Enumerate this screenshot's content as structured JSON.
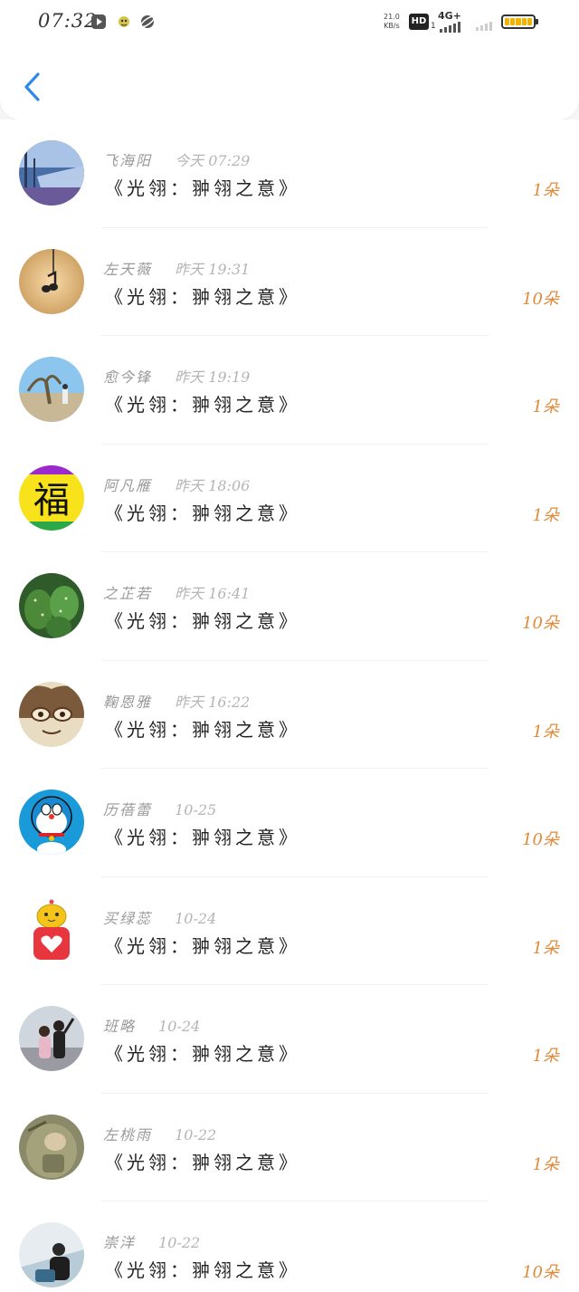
{
  "status_bar": {
    "time": "07:32",
    "net_speed_value": "21.0",
    "net_speed_unit": "KB/s",
    "hd_label": "HD",
    "hd_sub": "1",
    "network_type": "4G+",
    "icons": [
      "play-icon",
      "bird-icon",
      "planet-icon",
      "signal-icon",
      "battery-icon"
    ]
  },
  "header": {
    "back_icon": "chevron-left-icon"
  },
  "colors": {
    "back": "#2e8ae6",
    "amount": "#e08a3a",
    "title": "#222222",
    "meta": "#9a9a9a"
  },
  "gifts": [
    {
      "name": "飞海阳",
      "time": "今天 07:29",
      "title": "《光翎：翀翎之意》",
      "amount": "1朵"
    },
    {
      "name": "左天薇",
      "time": "昨天 19:31",
      "title": "《光翎：翀翎之意》",
      "amount": "10朵"
    },
    {
      "name": "愈今锋",
      "time": "昨天 19:19",
      "title": "《光翎：翀翎之意》",
      "amount": "1朵"
    },
    {
      "name": "阿凡雁",
      "time": "昨天 18:06",
      "title": "《光翎：翀翎之意》",
      "amount": "1朵"
    },
    {
      "name": "之芷若",
      "time": "昨天 16:41",
      "title": "《光翎：翀翎之意》",
      "amount": "10朵"
    },
    {
      "name": "鞠恩雅",
      "time": "昨天 16:22",
      "title": "《光翎：翀翎之意》",
      "amount": "1朵"
    },
    {
      "name": "历蓓蕾",
      "time": "10-25",
      "title": "《光翎：翀翎之意》",
      "amount": "10朵"
    },
    {
      "name": "买绿蕊",
      "time": "10-24",
      "title": "《光翎：翀翎之意》",
      "amount": "1朵"
    },
    {
      "name": "班略",
      "time": "10-24",
      "title": "《光翎：翀翎之意》",
      "amount": "1朵"
    },
    {
      "name": "左桃雨",
      "time": "10-22",
      "title": "《光翎：翀翎之意》",
      "amount": "1朵"
    },
    {
      "name": "崇洋",
      "time": "10-22",
      "title": "《光翎：翀翎之意》",
      "amount": "10朵"
    }
  ],
  "avatar_text": {
    "fu_character": "福"
  }
}
